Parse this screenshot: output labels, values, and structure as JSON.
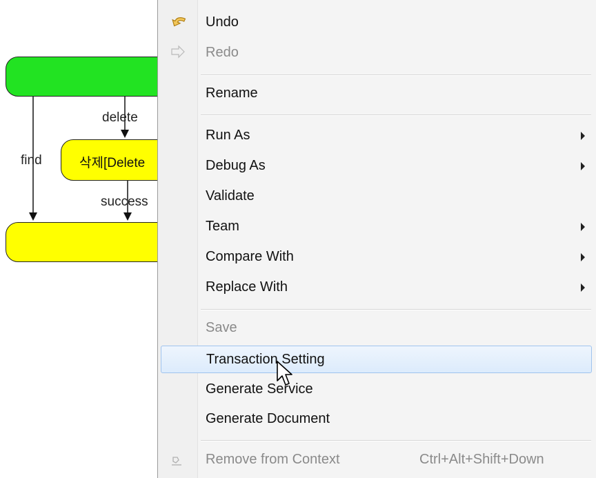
{
  "diagram": {
    "delete_node_label": "삭제[Delete",
    "edge_labels": {
      "delete": "delete",
      "find": "find",
      "success": "success"
    },
    "colors": {
      "start_node": "#22e322",
      "task_node": "#ffff00"
    }
  },
  "menu": {
    "items": [
      {
        "label": "Undo",
        "icon": "undo-arrow-icon",
        "enabled": true
      },
      {
        "label": "Redo",
        "icon": "redo-arrow-icon",
        "enabled": false
      },
      {
        "label": "Rename",
        "enabled": true
      },
      {
        "label": "Run As",
        "submenu": true
      },
      {
        "label": "Debug As",
        "submenu": true
      },
      {
        "label": "Validate"
      },
      {
        "label": "Team",
        "submenu": true
      },
      {
        "label": "Compare With",
        "submenu": true
      },
      {
        "label": "Replace With",
        "submenu": true
      },
      {
        "label": "Save",
        "enabled": false
      },
      {
        "label": "Transaction Setting",
        "highlighted": true
      },
      {
        "label": "Generate Service"
      },
      {
        "label": "Generate Document"
      },
      {
        "label": "Remove from Context",
        "shortcut": "Ctrl+Alt+Shift+Down",
        "icon": "remove-context-icon",
        "enabled": false
      }
    ],
    "colors": {
      "highlight_border": "#9fc3ee",
      "disabled_text": "#8a8a8a"
    }
  }
}
